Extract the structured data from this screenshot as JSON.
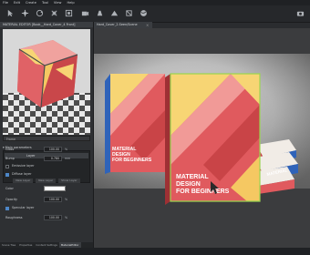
{
  "menu": [
    "File",
    "Edit",
    "Create",
    "Tool",
    "View",
    "Help"
  ],
  "toolbar": {
    "buttons": [
      "select-tool",
      "move-tool",
      "rotate-tool",
      "scale-tool",
      "frame-tool",
      "camera-tool",
      "light-tool",
      "share-tool",
      "render-tool",
      "environment-tool"
    ]
  },
  "left_panel": {
    "title": "MATERIAL EDITOR [Book__Hard_Cover_4 Front]",
    "preview_label": "Frame",
    "section_title": "Main parameters",
    "layer_name": "Layer",
    "layer_buttons": [
      "New Layer",
      "New Layer",
      "Show Layer"
    ],
    "properties": {
      "gloss_label": "Gloss",
      "gloss_value": "100.00",
      "gloss_unit": "%",
      "bump_label": "Bump",
      "bump_value": "0.780",
      "bump_unit": "mm",
      "emissive_label": "Emissive layer",
      "diffuse_label": "Diffuse layer",
      "color_label": "Color",
      "opacity_label": "Opacity",
      "opacity_value": "100.00",
      "opacity_unit": "%",
      "specular_label": "Specular layer",
      "roughness_label": "Roughness",
      "roughness_value": "100.00",
      "roughness_unit": "%"
    },
    "tabs": [
      "Scene Tree",
      "Properties",
      "Content Settings",
      "MaterialEditor"
    ]
  },
  "viewport": {
    "tab_label": "Hard_Cover_2.Seen/Scene",
    "book": {
      "title_line1": "MATERIAL",
      "title_line2": "DESIGN",
      "title_line3": "FOR BEGINNERS",
      "spine_text": "MATERIAL"
    },
    "colors": {
      "cover_red": "#e05a5e",
      "cover_dark_red": "#c94447",
      "cover_pink": "#f19a97",
      "cover_yellow": "#f7d574",
      "spine_blue": "#2f63b9",
      "selection_green": "#9bd450"
    }
  }
}
